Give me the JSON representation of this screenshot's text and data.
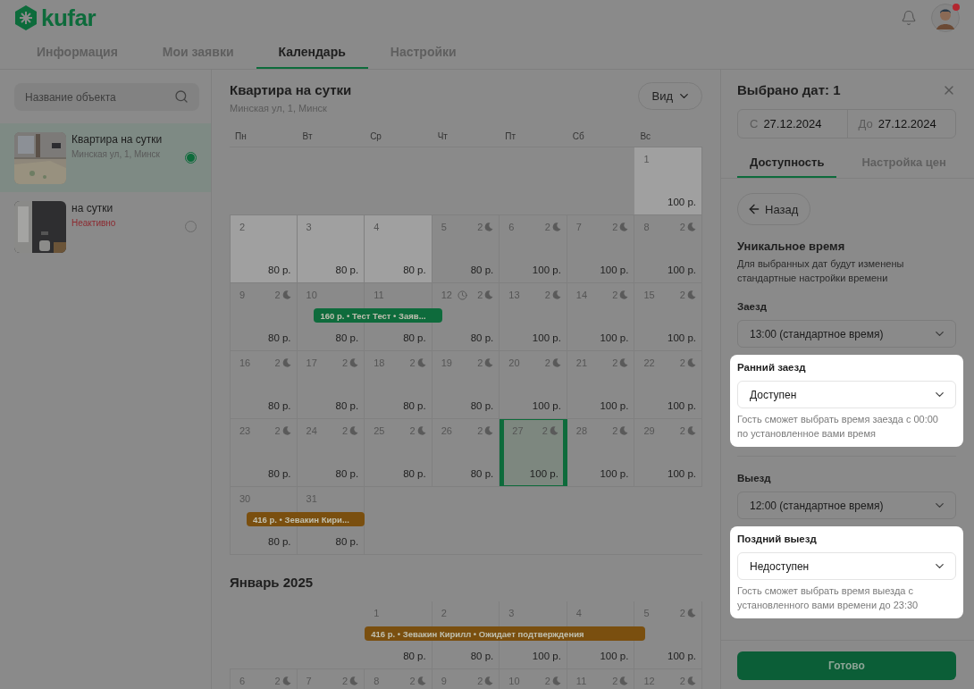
{
  "header": {
    "logo": "kufar",
    "notification": true
  },
  "tabs": [
    {
      "label": "Информация",
      "selected": false
    },
    {
      "label": "Мои заявки",
      "selected": false
    },
    {
      "label": "Календарь",
      "selected": true
    },
    {
      "label": "Настройки",
      "selected": false
    }
  ],
  "sidebar": {
    "search": {
      "placeholder": "Название объекта"
    },
    "items": [
      {
        "title": "Квартира на сутки",
        "subtitle": "Минская ул, 1, Минск",
        "inactive": false,
        "selected": true
      },
      {
        "title": "на сутки",
        "subtitle": "Неактивно",
        "inactive": true,
        "selected": false
      }
    ]
  },
  "calendar": {
    "title": "Квартира на сутки",
    "address": "Минская ул, 1, Минск",
    "view_button": "Вид",
    "weekdays": [
      "Пн",
      "Вт",
      "Ср",
      "Чт",
      "Пт",
      "Сб",
      "Вс"
    ],
    "months": [
      {
        "weeks": [
          [
            {
              "kind": "empty"
            },
            {
              "kind": "empty"
            },
            {
              "kind": "empty"
            },
            {
              "kind": "empty"
            },
            {
              "kind": "empty"
            },
            {
              "kind": "empty"
            },
            {
              "kind": "day",
              "day": "1",
              "price": "100 р.",
              "blocked": true,
              "selected": false
            }
          ],
          [
            {
              "kind": "day",
              "day": "2",
              "price": "80 р.",
              "blocked": true,
              "selected": false
            },
            {
              "kind": "day",
              "day": "3",
              "price": "80 р.",
              "blocked": true,
              "selected": false
            },
            {
              "kind": "day",
              "day": "4",
              "price": "80 р.",
              "blocked": true,
              "selected": false
            },
            {
              "kind": "day",
              "day": "5",
              "nights": "2",
              "price": "80 р.",
              "blocked": false,
              "selected": false
            },
            {
              "kind": "day",
              "day": "6",
              "nights": "2",
              "price": "100 р.",
              "blocked": false,
              "selected": false
            },
            {
              "kind": "day",
              "day": "7",
              "nights": "2",
              "price": "100 р.",
              "blocked": false,
              "selected": false
            },
            {
              "kind": "day",
              "day": "8",
              "nights": "2",
              "price": "100 р.",
              "blocked": false,
              "selected": false
            }
          ],
          [
            {
              "kind": "day",
              "day": "9",
              "nights": "2",
              "price": "80 р.",
              "blocked": false,
              "selected": false
            },
            {
              "kind": "day",
              "day": "10",
              "price": "80 р.",
              "blocked": false,
              "selected": false,
              "check_in": true,
              "booking": {
                "label": "160 р. • Тест Тест • Заяв...",
                "color": "#0e6b3c"
              }
            },
            {
              "kind": "day",
              "day": "11",
              "price": "80 р.",
              "blocked": false,
              "selected": false,
              "occupied": true
            },
            {
              "kind": "day",
              "day": "12",
              "clock": true,
              "nights": "2",
              "price": "80 р.",
              "blocked": false,
              "selected": false,
              "check_out": true
            },
            {
              "kind": "day",
              "day": "13",
              "nights": "2",
              "price": "100 р.",
              "blocked": false,
              "selected": false
            },
            {
              "kind": "day",
              "day": "14",
              "nights": "2",
              "price": "100 р.",
              "blocked": false,
              "selected": false
            },
            {
              "kind": "day",
              "day": "15",
              "nights": "2",
              "price": "100 р.",
              "blocked": false,
              "selected": false
            }
          ],
          [
            {
              "kind": "day",
              "day": "16",
              "nights": "2",
              "price": "80 р.",
              "blocked": false,
              "selected": false
            },
            {
              "kind": "day",
              "day": "17",
              "nights": "2",
              "price": "80 р.",
              "blocked": false,
              "selected": false
            },
            {
              "kind": "day",
              "day": "18",
              "nights": "2",
              "price": "80 р.",
              "blocked": false,
              "selected": false
            },
            {
              "kind": "day",
              "day": "19",
              "nights": "2",
              "price": "80 р.",
              "blocked": false,
              "selected": false
            },
            {
              "kind": "day",
              "day": "20",
              "nights": "2",
              "price": "100 р.",
              "blocked": false,
              "selected": false
            },
            {
              "kind": "day",
              "day": "21",
              "nights": "2",
              "price": "100 р.",
              "blocked": false,
              "selected": false
            },
            {
              "kind": "day",
              "day": "22",
              "nights": "2",
              "price": "100 р.",
              "blocked": false,
              "selected": false
            }
          ],
          [
            {
              "kind": "day",
              "day": "23",
              "nights": "2",
              "price": "80 р.",
              "blocked": false,
              "selected": false
            },
            {
              "kind": "day",
              "day": "24",
              "nights": "2",
              "price": "80 р.",
              "blocked": false,
              "selected": false
            },
            {
              "kind": "day",
              "day": "25",
              "nights": "2",
              "price": "80 р.",
              "blocked": false,
              "selected": false
            },
            {
              "kind": "day",
              "day": "26",
              "nights": "2",
              "price": "80 р.",
              "blocked": false,
              "selected": false
            },
            {
              "kind": "day",
              "day": "27",
              "nights": "2",
              "price": "100 р.",
              "blocked": false,
              "selected": true
            },
            {
              "kind": "day",
              "day": "28",
              "nights": "2",
              "price": "100 р.",
              "blocked": false,
              "selected": false
            },
            {
              "kind": "day",
              "day": "29",
              "nights": "2",
              "price": "100 р.",
              "blocked": false,
              "selected": false
            }
          ],
          [
            {
              "kind": "day",
              "day": "30",
              "price": "80 р.",
              "blocked": false,
              "selected": false,
              "check_in": true,
              "booking": {
                "label": "416 р. • Зевакин Кири...",
                "color": "#7a4f0f"
              }
            },
            {
              "kind": "day",
              "day": "31",
              "price": "80 р.",
              "blocked": false,
              "selected": false,
              "occupied": true
            }
          ]
        ]
      },
      {
        "title": "Январь 2025",
        "weeks": [
          [
            {
              "kind": "empty"
            },
            {
              "kind": "empty"
            },
            {
              "kind": "day",
              "day": "1",
              "price": "80 р.",
              "blocked": false,
              "selected": false,
              "booking": {
                "label": "416 р. • Зевакин Кирилл • Ожидает подтверждения",
                "color": "#7a4f0f"
              }
            },
            {
              "kind": "day",
              "day": "2",
              "price": "80 р.",
              "blocked": false,
              "selected": false,
              "occupied": true
            },
            {
              "kind": "day",
              "day": "3",
              "price": "100 р.",
              "blocked": false,
              "selected": false,
              "occupied": true
            },
            {
              "kind": "day",
              "day": "4",
              "price": "100 р.",
              "blocked": false,
              "selected": false,
              "occupied": true
            },
            {
              "kind": "day",
              "day": "5",
              "nights": "2",
              "price": "100 р.",
              "blocked": false,
              "selected": false,
              "check_out": true
            }
          ],
          [
            {
              "kind": "day",
              "day": "6",
              "nights": "2",
              "blocked": false,
              "selected": false
            },
            {
              "kind": "day",
              "day": "7",
              "nights": "2",
              "blocked": false,
              "selected": false
            },
            {
              "kind": "day",
              "day": "8",
              "nights": "2",
              "blocked": false,
              "selected": false
            },
            {
              "kind": "day",
              "day": "9",
              "nights": "2",
              "blocked": false,
              "selected": false
            },
            {
              "kind": "day",
              "day": "10",
              "nights": "2",
              "blocked": false,
              "selected": false
            },
            {
              "kind": "day",
              "day": "11",
              "nights": "2",
              "blocked": false,
              "selected": false
            },
            {
              "kind": "day",
              "day": "12",
              "nights": "2",
              "blocked": false,
              "selected": false
            }
          ]
        ]
      }
    ]
  },
  "panel": {
    "title": "Выбрано дат: 1",
    "date_from": {
      "label": "С",
      "value": "27.12.2024"
    },
    "date_to": {
      "label": "До",
      "value": "27.12.2024"
    },
    "tabs": [
      {
        "label": "Доступность",
        "selected": true
      },
      {
        "label": "Настройка цен",
        "selected": false
      }
    ],
    "back_button": "Назад",
    "section_title": "Уникальное время",
    "section_text": "Для выбранных дат будут изменены стандартные настройки времени",
    "groups": [
      {
        "label": "Заезд",
        "value": "13:00 (стандартное время)",
        "highlighted": false
      },
      {
        "label": "Ранний заезд",
        "value": "Доступен",
        "hint": "Гость сможет выбрать время заезда с 00:00 по установленное вами время",
        "highlighted": true
      },
      {
        "kind": "divider"
      },
      {
        "label": "Выезд",
        "value": "12:00 (стандартное время)",
        "highlighted": false
      },
      {
        "label": "Поздний выезд",
        "value": "Недоступен",
        "hint": "Гость сможет выбрать время выезда с установленного вами времени до 23:30",
        "highlighted": true
      }
    ],
    "done_button": "Готово"
  }
}
